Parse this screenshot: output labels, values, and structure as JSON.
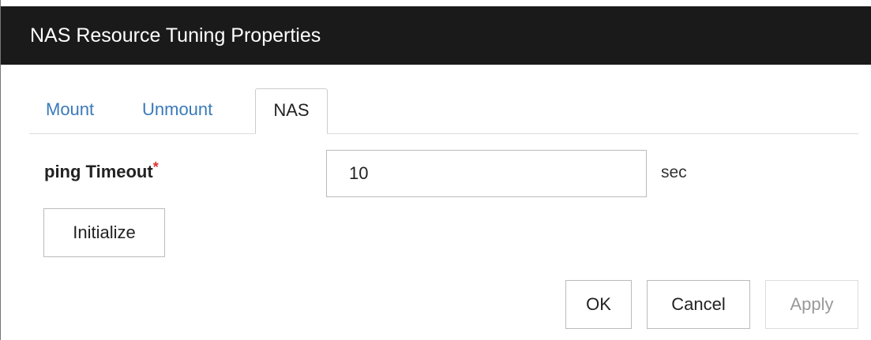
{
  "dialog": {
    "title": "NAS Resource Tuning Properties"
  },
  "tabs": [
    {
      "label": "Mount",
      "active": false
    },
    {
      "label": "Unmount",
      "active": false
    },
    {
      "label": "NAS",
      "active": true
    }
  ],
  "form": {
    "ping_timeout": {
      "label": "ping Timeout",
      "required_mark": "*",
      "value": "10",
      "unit": "sec"
    },
    "initialize_label": "Initialize"
  },
  "footer": {
    "ok_label": "OK",
    "cancel_label": "Cancel",
    "apply_label": "Apply",
    "apply_enabled": false
  },
  "colors": {
    "titlebar": "#1a1a1a",
    "tab_link": "#3a7ab9",
    "required": "#e03030"
  }
}
